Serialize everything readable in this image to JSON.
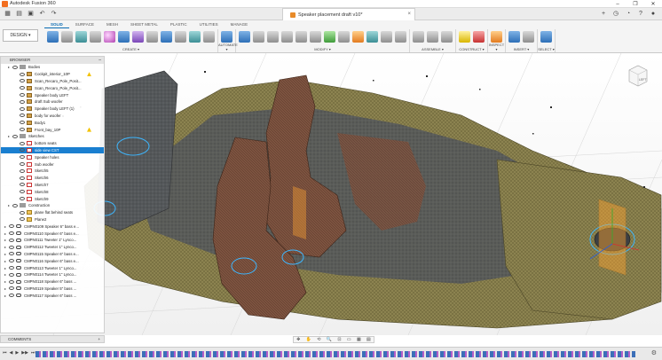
{
  "window": {
    "app_title": "Autodesk Fusion 360",
    "controls": [
      "–",
      "❐",
      "✕"
    ]
  },
  "tab": {
    "doc_title": "Speaker placement draft v10*",
    "close": "×"
  },
  "ribbon": {
    "workspace": "DESIGN ▾",
    "tabs": [
      "SOLID",
      "SURFACE",
      "MESH",
      "SHEET METAL",
      "PLASTIC",
      "UTILITIES",
      "MANAGE"
    ],
    "active_tab": "SOLID",
    "groups": [
      {
        "label": "CREATE ▾",
        "tools": [
          "t-blue",
          "t-gray",
          "t-teal",
          "t-gray",
          "t-ball",
          "t-blue",
          "t-purple",
          "t-gray",
          "t-blue",
          "t-gray",
          "t-teal",
          "t-gray"
        ]
      },
      {
        "label": "AUTOMATE ▾",
        "tools": [
          "t-blue"
        ]
      },
      {
        "label": "MODIFY ▾",
        "tools": [
          "t-blue",
          "t-gray",
          "t-gray",
          "t-gray",
          "t-gray",
          "t-gray",
          "t-green",
          "t-gray",
          "t-orange",
          "t-teal",
          "t-gray",
          "t-gray"
        ]
      },
      {
        "label": "ASSEMBLE ▾",
        "tools": [
          "t-gray",
          "t-gray",
          "t-gray"
        ]
      },
      {
        "label": "CONSTRUCT ▾",
        "tools": [
          "t-yellow",
          "t-red"
        ]
      },
      {
        "label": "INSPECT ▾",
        "tools": [
          "t-orange"
        ]
      },
      {
        "label": "INSERT ▾",
        "tools": [
          "t-blue",
          "t-gray"
        ]
      },
      {
        "label": "SELECT ▾",
        "tools": [
          "t-blue"
        ]
      }
    ]
  },
  "browser": {
    "title": "BROWSER",
    "rows": [
      {
        "type": "folder",
        "label": "Bodies",
        "indent": 8
      },
      {
        "type": "body",
        "label": "Cockpit_interior_10P",
        "indent": 16,
        "warn": true
      },
      {
        "type": "body",
        "label": "Scan_Recaro_Pole_Posit...",
        "indent": 16
      },
      {
        "type": "body",
        "label": "Scan_Recaro_Pole_Posit...",
        "indent": 16
      },
      {
        "type": "body",
        "label": "Speaker body LEFT",
        "indent": 16
      },
      {
        "type": "body",
        "label": "draft Sub woofer",
        "indent": 16
      },
      {
        "type": "body",
        "label": "Speaker body LEFT (1)",
        "indent": 16
      },
      {
        "type": "body",
        "label": "body for woofer",
        "indent": 16
      },
      {
        "type": "body",
        "label": "Body1",
        "indent": 16
      },
      {
        "type": "body",
        "label": "Front_bay_10P",
        "indent": 16,
        "warn": true
      },
      {
        "type": "folder",
        "label": "Sketches",
        "indent": 8
      },
      {
        "type": "sketch",
        "label": "bottom seats",
        "indent": 16
      },
      {
        "type": "sketch",
        "label": "side view CST",
        "indent": 16,
        "selected": true
      },
      {
        "type": "sketch",
        "label": "Speaker holes",
        "indent": 16
      },
      {
        "type": "sketch",
        "label": "Sub woofer",
        "indent": 16
      },
      {
        "type": "sketch",
        "label": "Sketch5",
        "indent": 16
      },
      {
        "type": "sketch",
        "label": "Sketch6",
        "indent": 16
      },
      {
        "type": "sketch",
        "label": "Sketch7",
        "indent": 16
      },
      {
        "type": "sketch",
        "label": "Sketch8",
        "indent": 16
      },
      {
        "type": "sketch",
        "label": "Sketch9",
        "indent": 16
      },
      {
        "type": "folder",
        "label": "Construction",
        "indent": 8
      },
      {
        "type": "plane",
        "label": "plane flat behind seats",
        "indent": 16
      },
      {
        "type": "plane",
        "label": "Plane2",
        "indent": 16
      },
      {
        "type": "link",
        "label": "CMPN0109 Speaker 6\" bass e...",
        "indent": 4
      },
      {
        "type": "link",
        "label": "CMPN0110 Speaker 6\" bass e...",
        "indent": 4
      },
      {
        "type": "link",
        "label": "CMPN0111 Tweeter 1\" Lynco...",
        "indent": 4
      },
      {
        "type": "link",
        "label": "CMPN0112 Tweeter 1\" Lynco...",
        "indent": 4
      },
      {
        "type": "link",
        "label": "CMPN0115 Speaker 6\" bass e...",
        "indent": 4
      },
      {
        "type": "link",
        "label": "CMPN0116 Speaker 6\" bass e...",
        "indent": 4
      },
      {
        "type": "link",
        "label": "CMPN0113 Tweeter 1\" Lynco...",
        "indent": 4
      },
      {
        "type": "link",
        "label": "CMPN0114 Tweeter 1\" Lynco...",
        "indent": 4
      },
      {
        "type": "link",
        "label": "CMPN0118 Speaker 6\" bass ...",
        "indent": 4
      },
      {
        "type": "link",
        "label": "CMPN0119 Speaker 5\" bass ...",
        "indent": 4
      },
      {
        "type": "link",
        "label": "CMPN0117 Speaker 6\" bass ...",
        "indent": 4
      }
    ]
  },
  "comments": {
    "label": "COMMENTS",
    "add": "+"
  },
  "navbar": {
    "icons": [
      "✥",
      "✋",
      "⟲",
      "🔍",
      "⊡",
      "▭",
      "▦",
      "▤"
    ]
  },
  "timeline": {
    "controls": [
      "⏮",
      "◀",
      "▶",
      "▶▶",
      "⏭"
    ],
    "gear": "⚙"
  },
  "viewcube": {
    "face": "LEFT"
  },
  "colors": {
    "accent": "#0a6bb3",
    "selected": "#1a7fd0",
    "mesh_olive": "#8f8550",
    "mesh_brown": "#7a5138",
    "mesh_gray": "#55585c"
  }
}
